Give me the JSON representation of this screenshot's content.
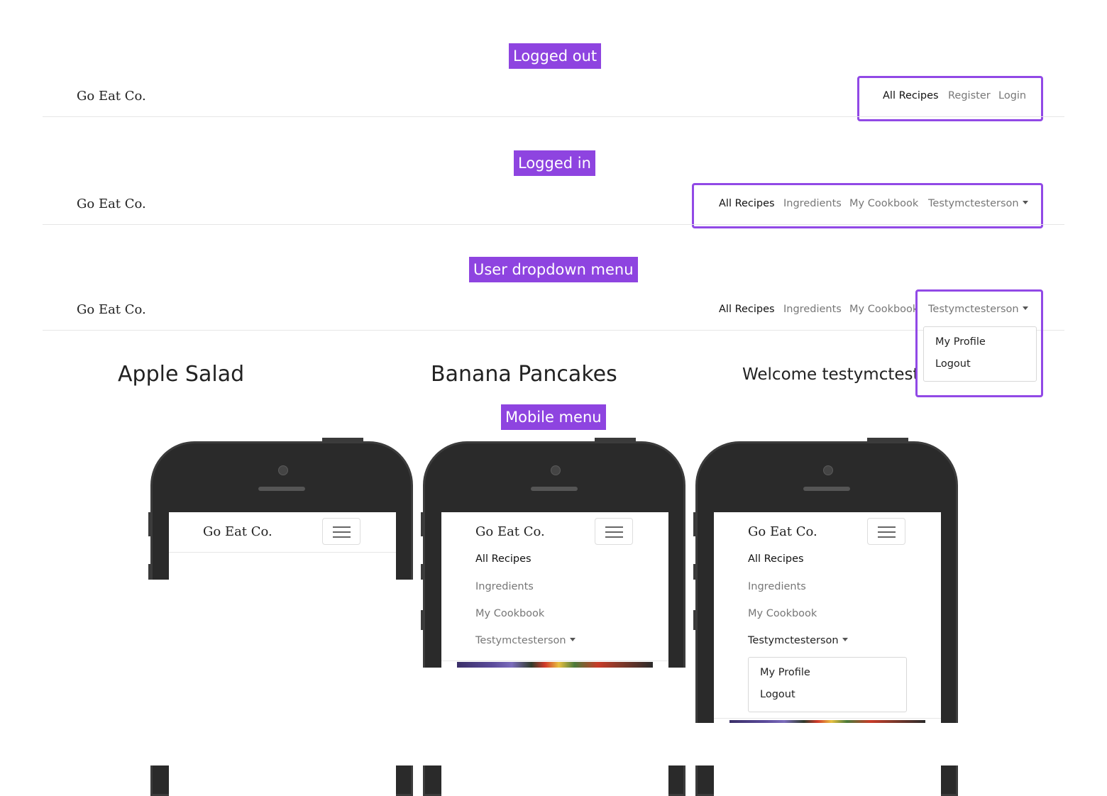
{
  "labels": {
    "logged_out": "Logged out",
    "logged_in": "Logged in",
    "user_dropdown": "User dropdown menu",
    "mobile_menu": "Mobile menu"
  },
  "brand": "Go Eat Co.",
  "nav_logged_out": {
    "all_recipes": "All Recipes",
    "register": "Register",
    "login": "Login"
  },
  "nav_logged_in": {
    "all_recipes": "All Recipes",
    "ingredients": "Ingredients",
    "my_cookbook": "My Cookbook",
    "user": "Testymctesterson"
  },
  "dropdown": {
    "my_profile": "My Profile",
    "logout": "Logout"
  },
  "content": {
    "card1_title": "Apple Salad",
    "card2_title": "Banana Pancakes",
    "welcome": "Welcome testymctesters"
  },
  "colors": {
    "highlight": "#9149e6",
    "label_bg": "#8e44e0"
  }
}
